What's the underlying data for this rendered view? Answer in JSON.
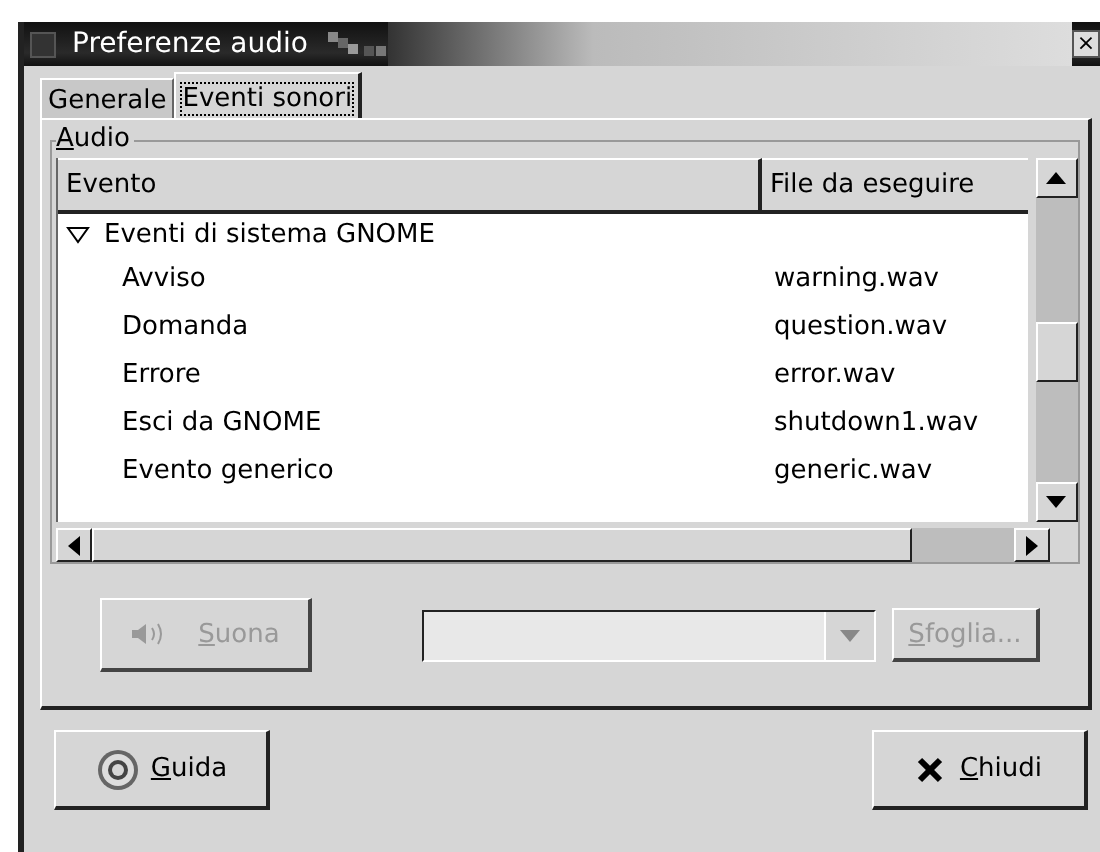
{
  "window": {
    "title": "Preferenze audio",
    "close": "×"
  },
  "tabs": [
    {
      "label": "Generale",
      "selected": false
    },
    {
      "label": "Eventi sonori",
      "selected": true
    }
  ],
  "group": {
    "label": "Audio"
  },
  "table": {
    "columns": [
      "Evento",
      "File da eseguire"
    ],
    "rows": [
      {
        "event": "Eventi di sistema GNOME",
        "file": "",
        "expanded": true,
        "children": [
          {
            "event": "Avviso",
            "file": "warning.wav"
          },
          {
            "event": "Domanda",
            "file": "question.wav"
          },
          {
            "event": "Errore",
            "file": "error.wav"
          },
          {
            "event": "Esci da GNOME",
            "file": "shutdown1.wav"
          },
          {
            "event": "Evento generico",
            "file": "generic.wav"
          }
        ]
      }
    ]
  },
  "play_button": {
    "label": "Suona",
    "disabled": true
  },
  "file_combo": {
    "disabled": true
  },
  "browse_button": {
    "label": "Sfoglia...",
    "disabled": true
  },
  "buttons": [
    {
      "kind": "help",
      "label": "Guida"
    },
    {
      "kind": "close",
      "label": "Chiudi"
    }
  ]
}
